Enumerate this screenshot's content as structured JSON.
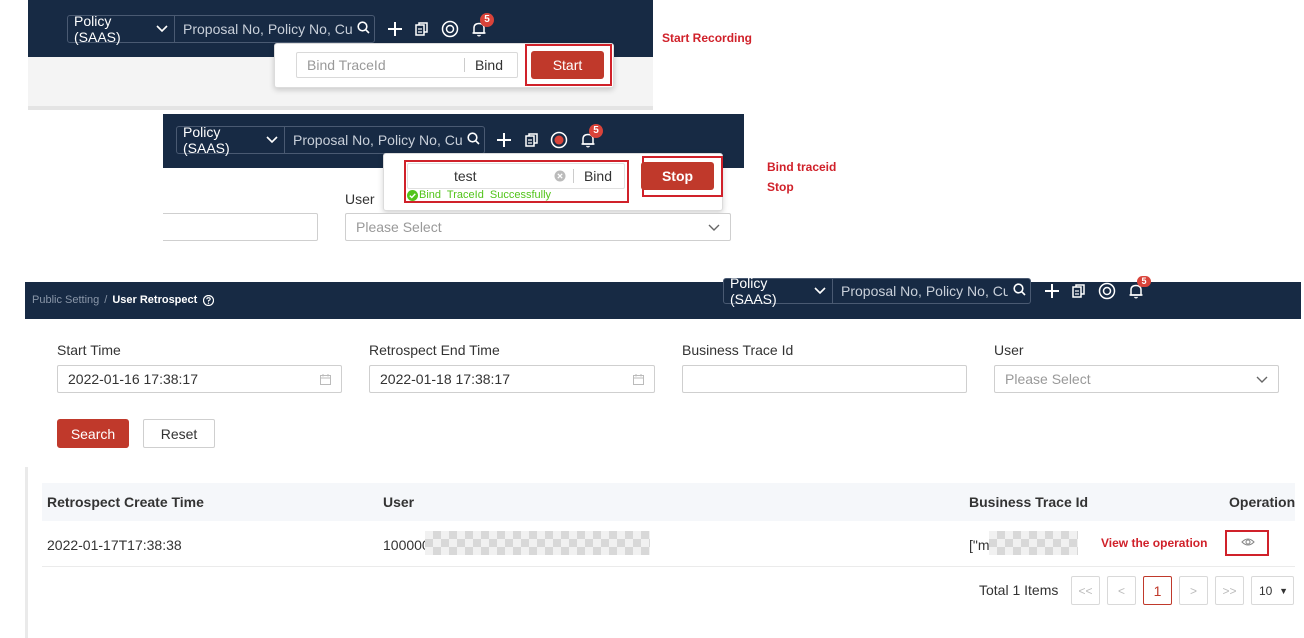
{
  "colors": {
    "navbar": "#172a44",
    "accent": "#c0392b",
    "annotation": "#d0212a",
    "success": "#52c41a"
  },
  "topbar": {
    "policy_label": "Policy (SAAS)",
    "search_placeholder": "Proposal No, Policy No, Cust",
    "notification_count": "5",
    "icons": [
      "search-icon",
      "plus-icon",
      "document-icon",
      "record-icon",
      "bell-icon"
    ]
  },
  "panel1": {
    "bind_placeholder": "Bind TraceId",
    "bind_label": "Bind",
    "start_label": "Start",
    "annotation": "Start Recording"
  },
  "panel2": {
    "bind_value": "test",
    "bind_label": "Bind",
    "stop_label": "Stop",
    "success_message": "Bind  TraceId  Successfully",
    "user_label": "User",
    "user_placeholder": "Please Select",
    "annotation_line1": "Bind traceid",
    "annotation_line2": "Stop"
  },
  "page": {
    "breadcrumb_parent": "Public Setting",
    "breadcrumb_sep": "/",
    "breadcrumb_current": "User Retrospect",
    "filters": {
      "start_time_label": "Start Time",
      "start_time_value": "2022-01-16 17:38:17",
      "end_time_label": "Retrospect End Time",
      "end_time_value": "2022-01-18 17:38:17",
      "trace_label": "Business Trace Id",
      "trace_value": "",
      "user_label": "User",
      "user_placeholder": "Please Select"
    },
    "search_label": "Search",
    "reset_label": "Reset",
    "table": {
      "headers": [
        "Retrospect Create Time",
        "User",
        "Business Trace Id",
        "Operation"
      ],
      "rows": [
        {
          "create_time": "2022-01-17T17:38:38",
          "user": "100000",
          "trace_id": "[\"m"
        }
      ]
    },
    "view_annotation": "View the operation",
    "pagination": {
      "total_text": "Total 1 Items",
      "first": "<<",
      "prev": "<",
      "current": "1",
      "next": ">",
      "last": ">>",
      "page_size": "10"
    }
  }
}
